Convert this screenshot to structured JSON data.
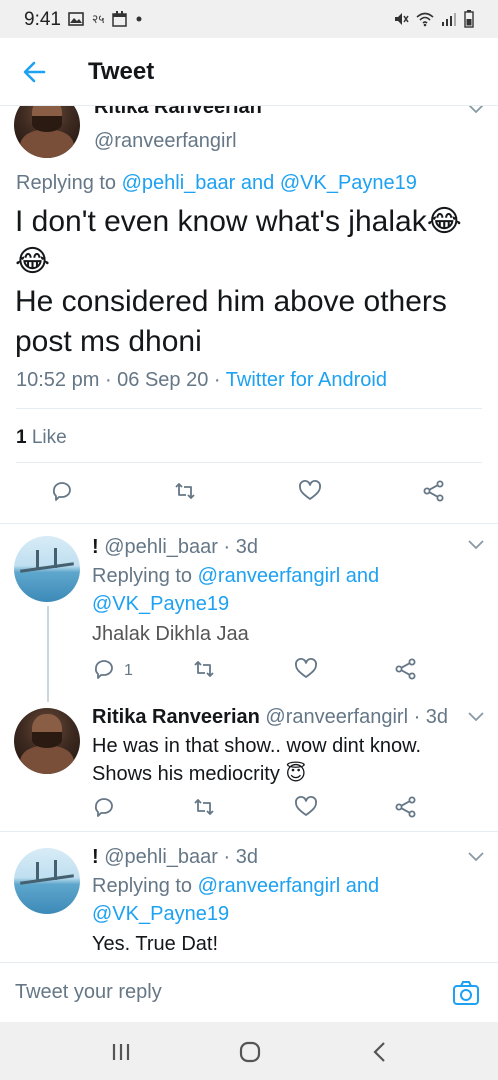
{
  "status_bar": {
    "time": "9:41",
    "notif_text": "२५"
  },
  "header": {
    "title": "Tweet"
  },
  "main_tweet": {
    "author_name": "Ritika Ranveerian",
    "author_handle": "@ranveerfangirl",
    "replying_prefix": "Replying to",
    "replying_user1": "@pehli_baar",
    "replying_and": "and",
    "replying_user2": "@VK_Payne19",
    "text_line1": "I don't even know what's jhalak😂",
    "text_line2": "😂",
    "text_line3": "He considered him above others",
    "text_line4": "post ms dhoni",
    "timestamp": "10:52 pm · 06 Sep 20 · ",
    "source": "Twitter for Android",
    "like_count": "1",
    "like_label": "Like"
  },
  "replies": [
    {
      "name": "!",
      "handle": "@pehli_baar",
      "time": "· 3d",
      "replying_prefix": "Replying to",
      "replying_user1": "@ranveerfangirl",
      "replying_and": "and",
      "replying_user2": "@VK_Payne19",
      "text": "Jhalak Dikhla Jaa",
      "reply_count": "1"
    },
    {
      "name": "Ritika Ranveerian",
      "handle": "@ranveerfangirl",
      "time": "· 3d",
      "text_line1": "He was in that show.. wow dint know.",
      "text_line2": "Shows his mediocrity 😇"
    },
    {
      "name": "!",
      "handle": "@pehli_baar",
      "time": "· 3d",
      "replying_prefix": "Replying to",
      "replying_user1": "@ranveerfangirl",
      "replying_and": "and",
      "replying_user2": "@VK_Payne19",
      "text": "Yes. True Dat!"
    }
  ],
  "reply_bar": {
    "placeholder": "Tweet your reply"
  },
  "colors": {
    "accent": "#1da1f2",
    "secondary_text": "#657786",
    "primary_text": "#14171a"
  }
}
